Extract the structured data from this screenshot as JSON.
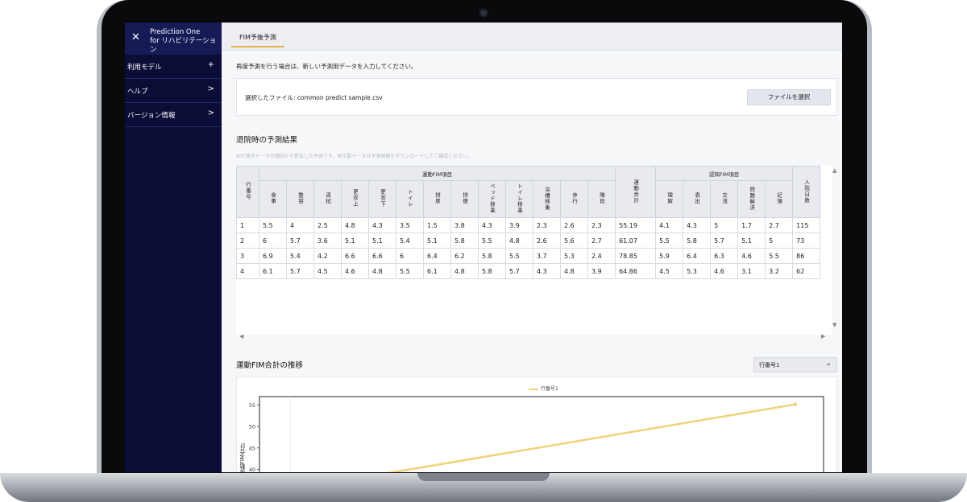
{
  "sidebar": {
    "title_line1": "Prediction One",
    "title_line2": "for リハビリテーション",
    "items": [
      {
        "label": "利用モデル",
        "icon": "plus-icon",
        "symbol": "+"
      },
      {
        "label": "ヘルプ",
        "icon": "chevron-right-icon",
        "symbol": ">"
      },
      {
        "label": "バージョン情報",
        "icon": "chevron-right-icon",
        "symbol": ">"
      }
    ]
  },
  "tabs": [
    {
      "label": "FIM予後予測"
    }
  ],
  "notice": "再度予測を行う場合は、新しい予測用データを入力してください。",
  "file": {
    "label_prefix": "選択したファイル: ",
    "name": "common predict sample.csv",
    "button": "ファイルを選択"
  },
  "results": {
    "title": "退院時の予測結果",
    "subtitle": "AIが過去データの傾向から算出した予測です。表示数データは予測画面をダウンロードしてご確認ください。",
    "headers": {
      "row_no": "行番号",
      "motor_group": "運動FIM項目",
      "motor_items": [
        "食事",
        "整容",
        "清拭",
        "更衣上",
        "更衣下",
        "トイレ",
        "排尿",
        "排便",
        "ベッド移乗",
        "トイレ移乗",
        "浴槽移乗",
        "歩行",
        "階段"
      ],
      "motor_total": "運動合計",
      "cognitive_group": "認知FIM項目",
      "cognitive_items": [
        "理解",
        "表出",
        "交流",
        "問題解決",
        "記憶"
      ],
      "hospital_days": "入院日数"
    },
    "rows": [
      [
        "1",
        "5.5",
        "4",
        "2.5",
        "4.8",
        "4.3",
        "3.5",
        "1.5",
        "3.8",
        "4.3",
        "3.9",
        "2.3",
        "2.6",
        "2.3",
        "55.19",
        "4.1",
        "4.3",
        "5",
        "1.7",
        "2.7",
        "115"
      ],
      [
        "2",
        "6",
        "5.7",
        "3.6",
        "5.1",
        "5.1",
        "5.4",
        "5.1",
        "5.8",
        "5.5",
        "4.8",
        "2.6",
        "5.6",
        "2.7",
        "61.07",
        "5.5",
        "5.8",
        "5.7",
        "5.1",
        "5",
        "73"
      ],
      [
        "3",
        "6.9",
        "5.4",
        "4.2",
        "6.6",
        "6.6",
        "6",
        "6.4",
        "6.2",
        "5.8",
        "5.5",
        "3.7",
        "5.3",
        "2.4",
        "78.85",
        "5.9",
        "6.4",
        "6.3",
        "4.6",
        "5.5",
        "86"
      ],
      [
        "4",
        "6.1",
        "5.7",
        "4.5",
        "4.6",
        "4.8",
        "5.5",
        "6.1",
        "4.8",
        "5.8",
        "5.7",
        "4.3",
        "4.8",
        "3.9",
        "64.86",
        "4.5",
        "5.3",
        "4.6",
        "3.1",
        "3.2",
        "62"
      ]
    ]
  },
  "trend": {
    "title": "運動FIM合計の推移",
    "select_value": "行番号1",
    "select_icon": "chevron-down-icon"
  },
  "chart_data": {
    "type": "line",
    "title": "",
    "legend": [
      "行番号1"
    ],
    "legend_position": "top-center",
    "ylabel": "運動FIM合計",
    "yticks": [
      40,
      45,
      50,
      55
    ],
    "ylim": [
      38,
      57
    ],
    "series": [
      {
        "name": "行番号1",
        "color": "#f0d27a",
        "points": [
          [
            0.2,
            38.5
          ],
          [
            0.95,
            55.19
          ]
        ]
      }
    ],
    "grid": false
  },
  "scroll": {
    "up": "▲",
    "down": "▼",
    "left": "◀",
    "right": "▶"
  }
}
